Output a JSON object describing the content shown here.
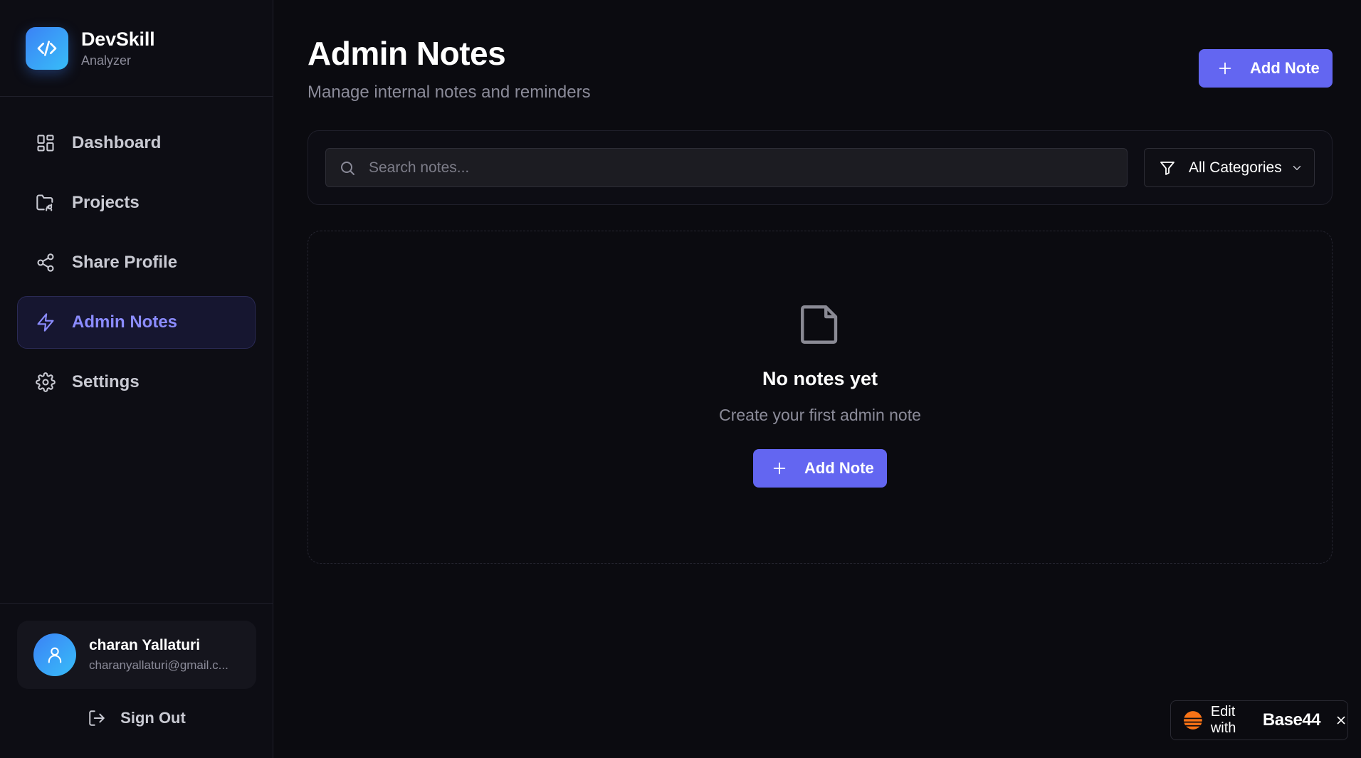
{
  "brand": {
    "name": "DevSkill",
    "subtitle": "Analyzer",
    "logo_icon": "code-icon"
  },
  "nav": {
    "items": [
      {
        "label": "Dashboard",
        "icon": "dashboard-grid-icon"
      },
      {
        "label": "Projects",
        "icon": "folder-icon"
      },
      {
        "label": "Share Profile",
        "icon": "share-icon"
      },
      {
        "label": "Admin Notes",
        "icon": "lightning-icon",
        "active": true
      },
      {
        "label": "Settings",
        "icon": "gear-icon"
      }
    ]
  },
  "user": {
    "name": "charan Yallaturi",
    "email": "charanyallaturi@gmail.c..."
  },
  "signout_label": "Sign Out",
  "header": {
    "title": "Admin Notes",
    "subtitle": "Manage internal notes and reminders",
    "add_button": "Add Note"
  },
  "search": {
    "placeholder": "Search notes...",
    "value": ""
  },
  "category_filter": {
    "selected": "All Categories"
  },
  "empty_state": {
    "title": "No notes yet",
    "subtitle": "Create your first admin note",
    "button": "Add Note"
  },
  "badge": {
    "text": "Edit with",
    "brand": "Base44"
  },
  "colors": {
    "accent": "#6366f1",
    "active_nav_text": "#8b8cff",
    "background": "#0b0b10",
    "brand_gradient_start": "#3b82f6",
    "brand_gradient_end": "#38bdf8"
  }
}
